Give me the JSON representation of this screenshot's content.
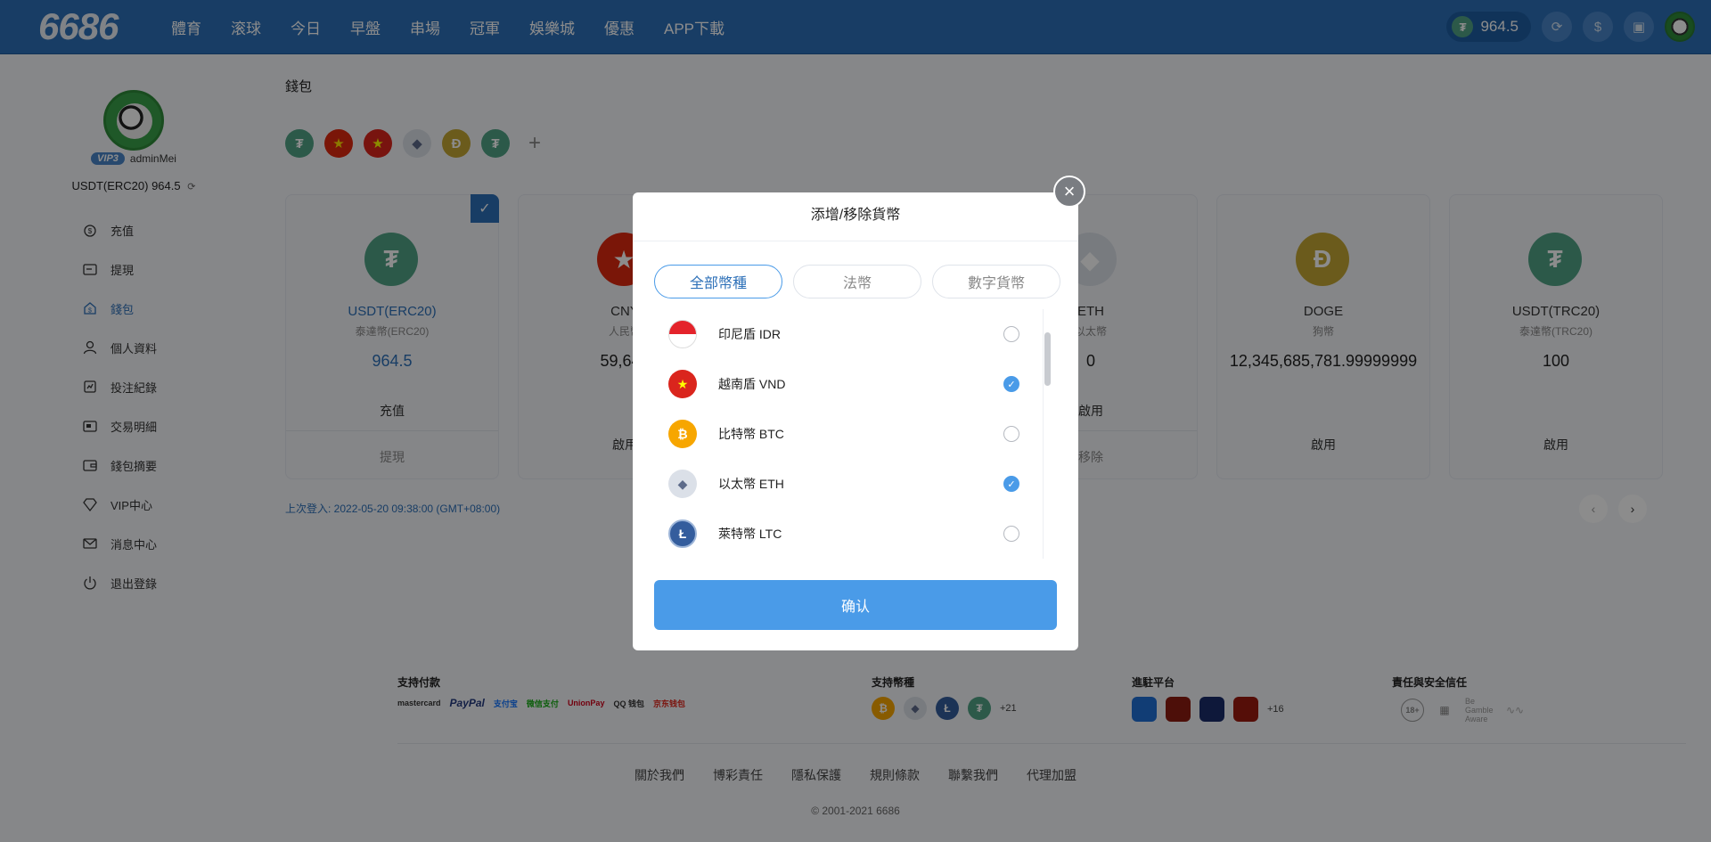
{
  "topbar": {
    "logo": "6686",
    "nav": [
      "體育",
      "滚球",
      "今日",
      "早盤",
      "串場",
      "冠軍",
      "娛樂城",
      "優惠",
      "APP下載"
    ],
    "balance": "964.5"
  },
  "sidebar": {
    "vip": "VIP3",
    "username": "adminMei",
    "balance_text": "USDT(ERC20) 964.5",
    "items": [
      {
        "label": "充值",
        "icon": "deposit-icon"
      },
      {
        "label": "提現",
        "icon": "withdraw-icon"
      },
      {
        "label": "錢包",
        "icon": "wallet-icon",
        "active": true
      },
      {
        "label": "個人資料",
        "icon": "user-icon"
      },
      {
        "label": "投注紀錄",
        "icon": "bet-record-icon"
      },
      {
        "label": "交易明細",
        "icon": "transaction-icon"
      },
      {
        "label": "錢包摘要",
        "icon": "wallet-summary-icon"
      },
      {
        "label": "VIP中心",
        "icon": "vip-icon"
      },
      {
        "label": "消息中心",
        "icon": "mail-icon"
      },
      {
        "label": "退出登錄",
        "icon": "logout-icon"
      }
    ]
  },
  "main": {
    "title": "錢包",
    "cards": [
      {
        "name": "USDT(ERC20)",
        "sub": "泰達幣(ERC20)",
        "value": "964.5",
        "act1": "充值",
        "act2": "提現"
      },
      {
        "name": "CNY",
        "sub": "人民幣",
        "value": "59,648",
        "single": "啟用"
      },
      {
        "name": "ETH",
        "sub": "以太幣",
        "value": "0",
        "act1": "啟用",
        "act2": "移除"
      },
      {
        "name": "DOGE",
        "sub": "狗幣",
        "value": "12,345,685,781.99999999",
        "single": "啟用"
      },
      {
        "name": "USDT(TRC20)",
        "sub": "泰達幣(TRC20)",
        "value": "100",
        "single": "啟用"
      }
    ],
    "last_login": "上次登入: 2022-05-20 09:38:00 (GMT+08:00)"
  },
  "footer": {
    "payments_title": "支持付款",
    "payments": [
      "mastercard",
      "PayPal",
      "支付宝",
      "微信支付",
      "UnionPay",
      "QQ 钱包",
      "京东钱包"
    ],
    "coins_title": "支持幣種",
    "coins_more": "+21",
    "platforms_title": "進駐平台",
    "platforms_more": "+16",
    "trust_title": "責任與安全信任",
    "trust": [
      "18+",
      "Be Gamble Aware"
    ],
    "links": [
      "關於我們",
      "博彩責任",
      "隱私保護",
      "規則條款",
      "聯繫我們",
      "代理加盟"
    ],
    "copyright": "© 2001-2021 6686"
  },
  "modal": {
    "title": "添增/移除貨幣",
    "tabs": [
      "全部幣種",
      "法幣",
      "數字貨幣"
    ],
    "rows": [
      {
        "label": "印尼盾 IDR",
        "checked": false
      },
      {
        "label": "越南盾 VND",
        "checked": true
      },
      {
        "label": "比特幣 BTC",
        "checked": false
      },
      {
        "label": "以太幣 ETH",
        "checked": true
      },
      {
        "label": "萊特幣 LTC",
        "checked": false
      }
    ],
    "confirm": "确认"
  }
}
